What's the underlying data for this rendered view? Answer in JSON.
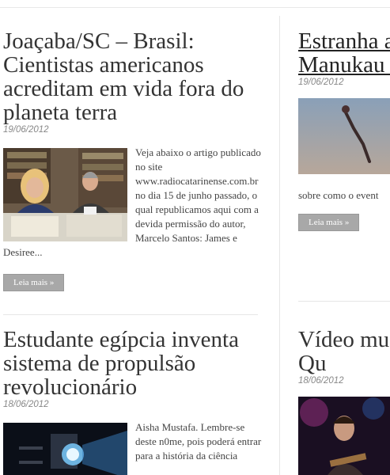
{
  "posts": [
    {
      "title": "Joaçaba/SC – Brasil: Cientistas americanos acreditam em vida fora do planeta terra",
      "date": "19/06/2012",
      "excerpt": "Veja abaixo o artigo publicado no site www.radiocatarinense.com.br no dia 15 de junho passado, o qual republicamos aqui com a devida permissão do autor, Marcelo Santos: James e Desiree...",
      "read_more": "Leia mais »"
    },
    {
      "title": "Estranha aparece n Manukau Zelândia",
      "date": "19/06/2012",
      "excerpt": "sobre como o event",
      "read_more": "Leia mais »"
    },
    {
      "title": "Estudante egípcia inventa sistema de propulsão revolucionário",
      "date": "18/06/2012",
      "excerpt": "Aisha Mustafa. Lembre-se deste n0me, pois poderá entrar para a história da ciência"
    },
    {
      "title": "Vídeo mu Eller – Qu",
      "date": "18/06/2012"
    }
  ]
}
